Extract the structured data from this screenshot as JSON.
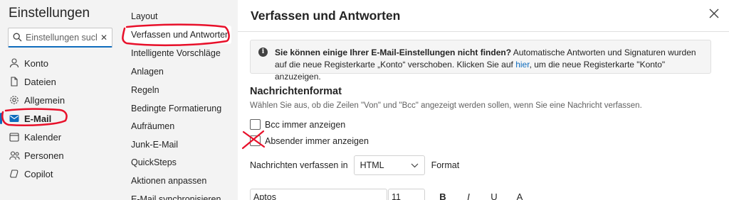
{
  "left": {
    "title": "Einstellungen",
    "search_placeholder": "Einstellungen suche",
    "nav": [
      {
        "label": "Konto",
        "icon": "person-icon"
      },
      {
        "label": "Dateien",
        "icon": "file-icon"
      },
      {
        "label": "Allgemein",
        "icon": "gear-icon"
      },
      {
        "label": "E-Mail",
        "icon": "mail-icon",
        "active": true
      },
      {
        "label": "Kalender",
        "icon": "calendar-icon"
      },
      {
        "label": "Personen",
        "icon": "people-icon"
      },
      {
        "label": "Copilot",
        "icon": "copilot-icon"
      }
    ]
  },
  "middle": {
    "items": [
      "Layout",
      "Verfassen und Antworten",
      "Intelligente Vorschläge",
      "Anlagen",
      "Regeln",
      "Bedingte Formatierung",
      "Aufräumen",
      "Junk-E-Mail",
      "QuickSteps",
      "Aktionen anpassen",
      "E-Mail synchronisieren"
    ],
    "active_index": 1
  },
  "main": {
    "title": "Verfassen und Antworten",
    "info": {
      "bold": "Sie können einige Ihrer E-Mail-Einstellungen nicht finden?",
      "text1": " Automatische Antworten und Signaturen wurden auf die neue Registerkarte „Konto“ verschoben. Klicken Sie auf ",
      "link": "hier",
      "text2": ", um die neue Registerkarte \"Konto\" anzuzeigen."
    },
    "section_title": "Nachrichtenformat",
    "section_desc": "Wählen Sie aus, ob die Zeilen \"Von\" und \"Bcc\" angezeigt werden sollen, wenn Sie eine Nachricht verfassen.",
    "checkbox_bcc": "Bcc immer anzeigen",
    "checkbox_from": "Absender immer anzeigen",
    "compose_label": "Nachrichten verfassen in",
    "compose_value": "HTML",
    "compose_suffix": "Format",
    "font_value": "Aptos",
    "size_value": "11",
    "bold_label": "B",
    "italic_label": "I",
    "underline_label": "U",
    "color_label": "A"
  },
  "colors": {
    "accent": "#0f6cbd",
    "annotation": "#e8102a"
  }
}
